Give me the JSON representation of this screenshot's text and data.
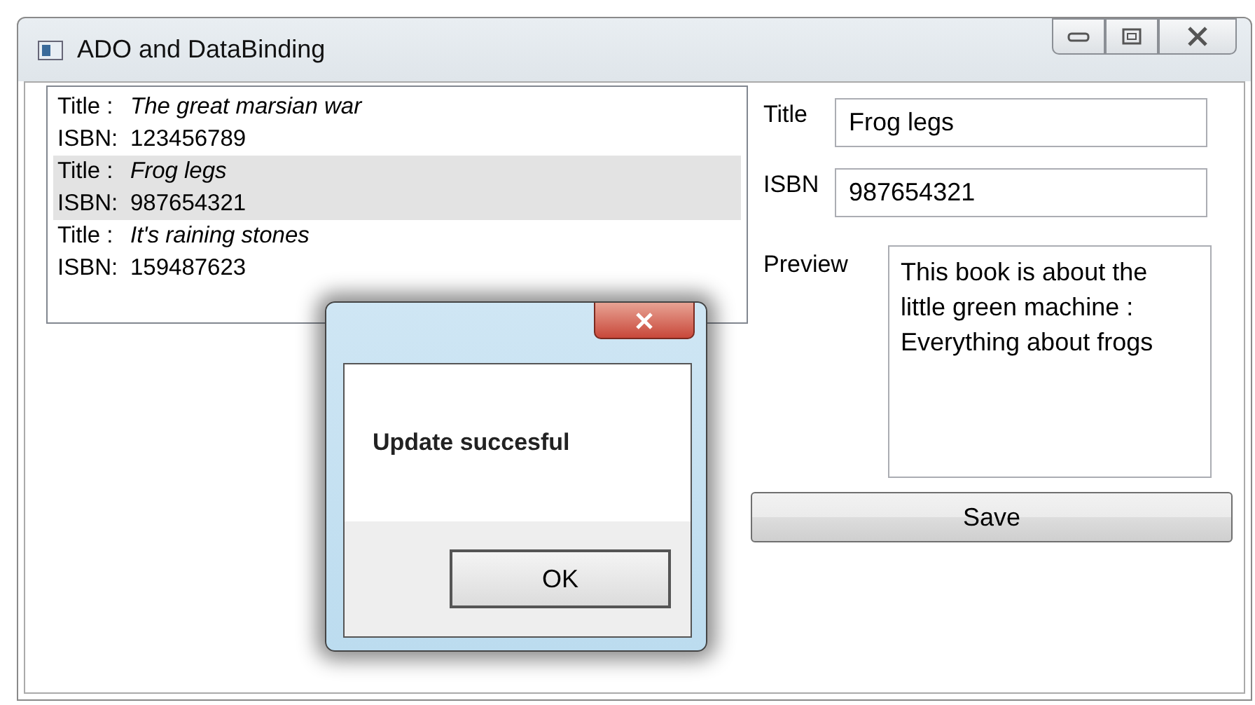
{
  "window": {
    "title": "ADO and DataBinding"
  },
  "books": [
    {
      "title_label": "Title :",
      "title": "The great marsian war",
      "isbn_label": "ISBN:",
      "isbn": "123456789",
      "selected": false
    },
    {
      "title_label": "Title :",
      "title": "Frog legs",
      "isbn_label": "ISBN:",
      "isbn": "987654321",
      "selected": true
    },
    {
      "title_label": "Title :",
      "title": "It's raining stones",
      "isbn_label": "ISBN:",
      "isbn": "159487623",
      "selected": false
    }
  ],
  "form": {
    "fields": [
      {
        "label": "Title",
        "value": "Frog legs"
      },
      {
        "label": "ISBN",
        "value": "987654321"
      }
    ],
    "preview": {
      "label": "Preview",
      "value": "This book is about the little green machine : Everything about frogs"
    },
    "save_button": "Save"
  },
  "dialog": {
    "message": "Update succesful",
    "button": "OK"
  }
}
